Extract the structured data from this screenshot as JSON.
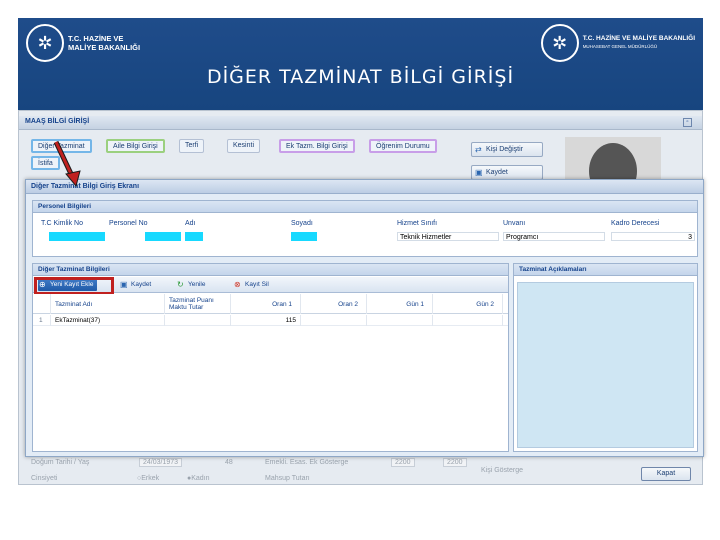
{
  "slide": {
    "title": "DİĞER TAZMİNAT BİLGİ GİRİŞİ",
    "logo_left_line1": "T.C. HAZİNE VE",
    "logo_left_line2": "MALİYE BAKANLIĞI",
    "logo_right_line1": "T.C. HAZİNE VE MALİYE BAKANLIĞI",
    "logo_right_line2": "MUHASEBAT GENEL MÜDÜRLÜĞÜ"
  },
  "background_window": {
    "title": "MAAŞ BİLGİ GİRİŞİ",
    "tabs": [
      "Diğer Tazminat",
      "Aile Bilgi Girişi",
      "Terfi",
      "Kesinti",
      "Ek Tazm. Bilgi Girişi",
      "Öğrenim Durumu"
    ],
    "tab_istifa": "İstifa",
    "kisi_degistir": "Kişi Değiştir",
    "kaydet": "Kaydet",
    "bottom_left_label": "Doğum Tarihi / Yaş",
    "bottom_left_value": "24/03/1973",
    "bottom_left_value2": "48",
    "bottom_left_label2": "Cinsiyeti",
    "radio_erkek": "Erkek",
    "radio_kadin": "Kadın",
    "bottom_mid_label": "Emekli. Esas. Ek Gösterge",
    "bottom_mid_value1": "2200",
    "bottom_mid_value2": "2200",
    "bottom_mid_label2": "Mahsup Tutarı",
    "bottom_right_label": "Kişi Gösterge",
    "close_button": "Kapat"
  },
  "modal": {
    "title": "Diğer Tazminat Bilgi Giriş Ekranı",
    "personnel_panel_title": "Personel Bilgileri",
    "personnel_columns": [
      "T.C Kimlik No",
      "Personel No",
      "Adı",
      "Soyadı",
      "Hizmet Sınıfı",
      "Unvanı",
      "Kadro Derecesi"
    ],
    "hizmet_sinifi": "Teknik Hizmetler",
    "unvani": "Programcı",
    "kadro_derecesi": "3",
    "tazminat_panel_title": "Diğer Tazminat Bilgileri",
    "aciklama_panel_title": "Tazminat Açıklamaları",
    "toolbar": {
      "new_record": "Yeni Kayıt Ekle",
      "save": "Kaydet",
      "refresh": "Yenile",
      "delete": "Kayıt Sil"
    },
    "grid_columns": [
      "Tazminat Adı",
      "Tazminat Puanı Maktu Tutar",
      "Oran 1",
      "Oran 2",
      "Gün 1",
      "Gün 2"
    ],
    "grid_rows": [
      {
        "no": "1",
        "name": "EkTazminat(37)",
        "puan": "",
        "oran1": "115",
        "oran2": "",
        "gun1": "",
        "gun2": ""
      }
    ]
  },
  "colors": {
    "header_blue": "#1f4c8a",
    "highlight_cyan": "#17d9ff",
    "annotation_red": "#c0201f"
  }
}
